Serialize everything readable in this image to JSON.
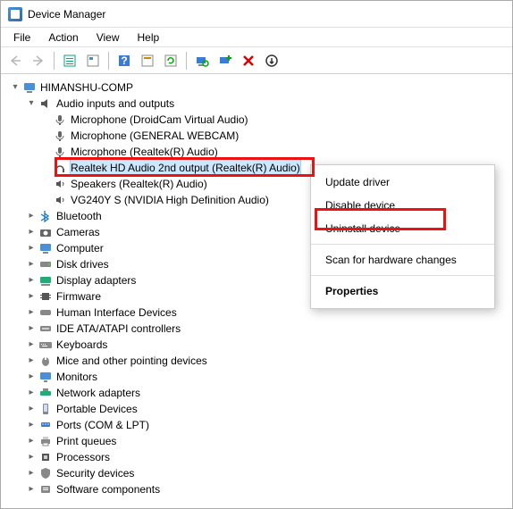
{
  "window": {
    "title": "Device Manager"
  },
  "menu": {
    "file": "File",
    "action": "Action",
    "view": "View",
    "help": "Help"
  },
  "root": {
    "computer": "HIMANSHU-COMP"
  },
  "categories": {
    "audio": "Audio inputs and outputs",
    "bluetooth": "Bluetooth",
    "cameras": "Cameras",
    "computer": "Computer",
    "disk": "Disk drives",
    "display": "Display adapters",
    "firmware": "Firmware",
    "hid": "Human Interface Devices",
    "ide": "IDE ATA/ATAPI controllers",
    "keyboards": "Keyboards",
    "mice": "Mice and other pointing devices",
    "monitors": "Monitors",
    "network": "Network adapters",
    "portable": "Portable Devices",
    "ports": "Ports (COM & LPT)",
    "printq": "Print queues",
    "processors": "Processors",
    "security": "Security devices",
    "software": "Software components"
  },
  "audio_devices": {
    "d0": "Microphone (DroidCam Virtual Audio)",
    "d1": "Microphone (GENERAL WEBCAM)",
    "d2": "Microphone (Realtek(R) Audio)",
    "d3": "Realtek HD Audio 2nd output (Realtek(R) Audio)",
    "d4": "Speakers (Realtek(R) Audio)",
    "d5": "VG240Y S (NVIDIA High Definition Audio)"
  },
  "context_menu": {
    "update": "Update driver",
    "disable": "Disable device",
    "uninstall": "Uninstall device",
    "scan": "Scan for hardware changes",
    "properties": "Properties"
  }
}
